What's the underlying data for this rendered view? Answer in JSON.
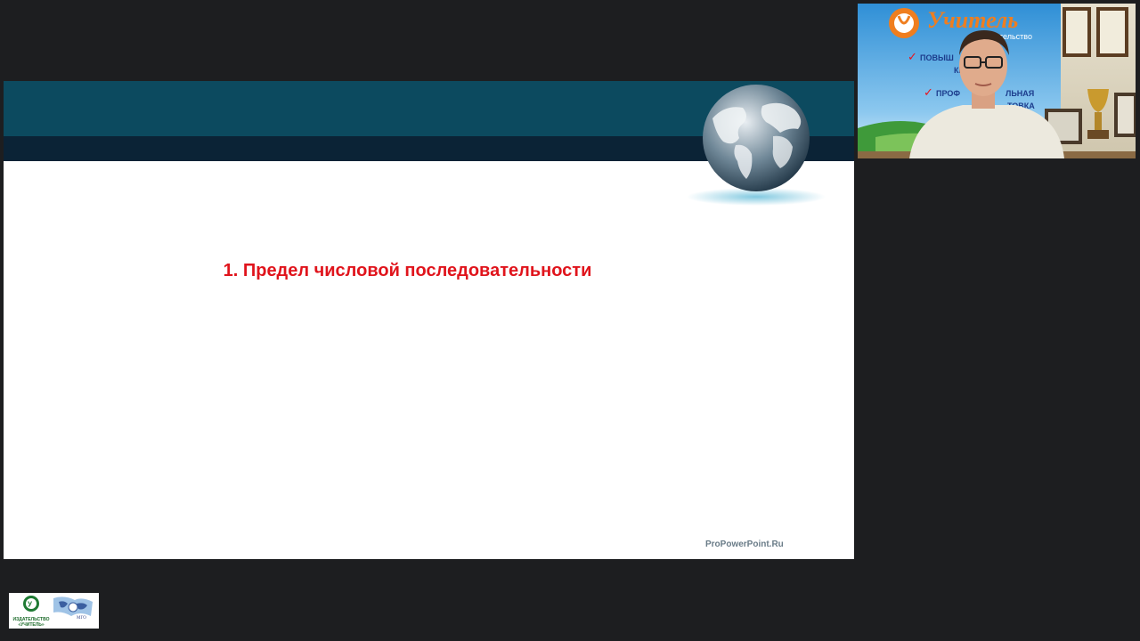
{
  "slide": {
    "title": "1. Предел числовой последовательности",
    "footer_credit": "ProPowerPoint.Ru"
  },
  "webcam": {
    "banner_text": "Учитель",
    "banner_subtext": "издательство",
    "list_items": [
      "ПОВЫШ",
      "КВА",
      "И",
      "ПРОФ",
      "ЛЬНАЯ",
      "ТОВКА"
    ]
  },
  "logo": {
    "line1": "ИЗДАТЕЛЬСТВО",
    "line2": "«УЧИТЕЛЬ»",
    "mgo": "МГО"
  },
  "colors": {
    "background": "#1d1e20",
    "band_top": "#0c4a5f",
    "band_bottom": "#0b2336",
    "title": "#e0141c"
  }
}
